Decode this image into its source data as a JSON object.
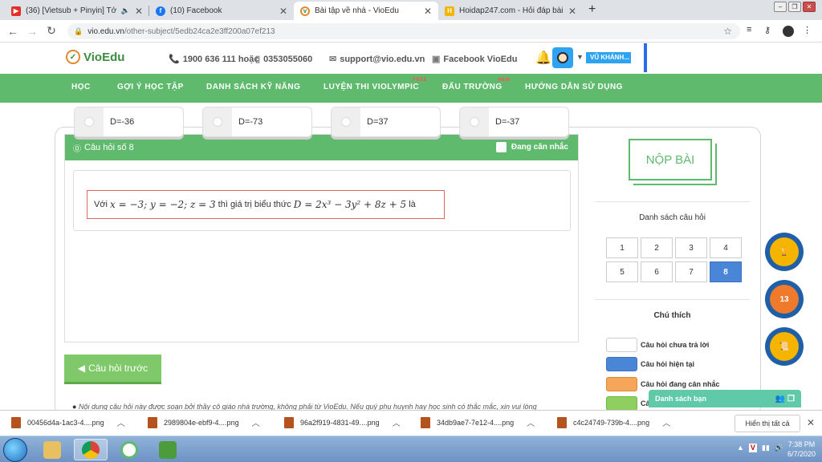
{
  "browser": {
    "tabs": [
      {
        "title": "(36) [Vietsub + Pinyin] Tớ và",
        "favicon_color": "#e52d27",
        "active": false
      },
      {
        "title": "(10) Facebook",
        "favicon_color": "#1877f2",
        "active": false
      },
      {
        "title": "Bài tập về nhà - VioEdu",
        "favicon_color": "#e08a2c",
        "active": true
      },
      {
        "title": "Hoidap247.com - Hỏi đáp bài tập",
        "favicon_color": "#f5b400",
        "active": false
      }
    ],
    "new_tab": "+",
    "url_host": "vio.edu.vn",
    "url_path": "/other-subject/5edb24ca2e3ff200a07ef213"
  },
  "site": {
    "logo_text": "VioEdu",
    "phone": "1900 636 111 hoặc",
    "mobile": "0353055060",
    "email": "support@vio.edu.vn",
    "facebook": "Facebook VioEdu",
    "user_name": "VŨ KHÁNH..."
  },
  "nav": {
    "items": [
      {
        "label": "HỌC",
        "tag": ""
      },
      {
        "label": "GỢI Ý HỌC TẬP",
        "tag": ""
      },
      {
        "label": "DANH SÁCH KỸ NĂNG",
        "tag": ""
      },
      {
        "label": "LUYỆN THI VIOLYMPIC",
        "tag": "FREE"
      },
      {
        "label": "ĐẤU TRƯỜNG",
        "tag": "NEW"
      },
      {
        "label": "HƯỚNG DẪN SỬ DỤNG",
        "tag": ""
      }
    ]
  },
  "question": {
    "header": "Câu hỏi số 8",
    "considering_label": "Đang cân nhắc",
    "prefix": "Với",
    "condition": "x = −3; y = −2; z = 3",
    "middle": "thì giá trị biểu thức",
    "expression": "D = 2x³ − 3y² + 8z + 5",
    "suffix": "là",
    "answers": [
      "D=-36",
      "D=-73",
      "D=37",
      "D=-37"
    ],
    "prev_button": "Câu hỏi trước",
    "note": "Nội dung câu hỏi này được soạn bởi thầy cô giáo nhà trường, không phải từ VioEdu. Nếu quý phụ huynh hay học sinh có thắc mắc, xin vui lòng"
  },
  "sidebar": {
    "submit": "NỘP BÀI",
    "list_title": "Danh sách câu hỏi",
    "questions": [
      "1",
      "2",
      "3",
      "4",
      "5",
      "6",
      "7",
      "8"
    ],
    "current": "8",
    "legend_title": "Chú thích",
    "legend": [
      {
        "label": "Câu hỏi chưa trả lời",
        "color": "#ffffff"
      },
      {
        "label": "Câu hỏi hiện tại",
        "color": "#4a86d8"
      },
      {
        "label": "Câu hỏi đang cân nhắc",
        "color": "#f5a65b"
      },
      {
        "label": "Câ",
        "color": "#8fcf5f"
      }
    ],
    "friends": "Danh sách bạn",
    "badge_level": "13"
  },
  "downloads": {
    "files": [
      "00456d4a-1ac3-4....png",
      "2989804e-ebf9-4....png",
      "96a2f919-4831-49....png",
      "34db9ae7-7e12-4....png",
      "c4c24749-739b-4....png"
    ],
    "show_all": "Hiển thị tất cả"
  },
  "taskbar": {
    "time": "7:38 PM",
    "date": "6/7/2020"
  },
  "colors": {
    "brand_green": "#5fba6e",
    "current_blue": "#4a86d8"
  }
}
